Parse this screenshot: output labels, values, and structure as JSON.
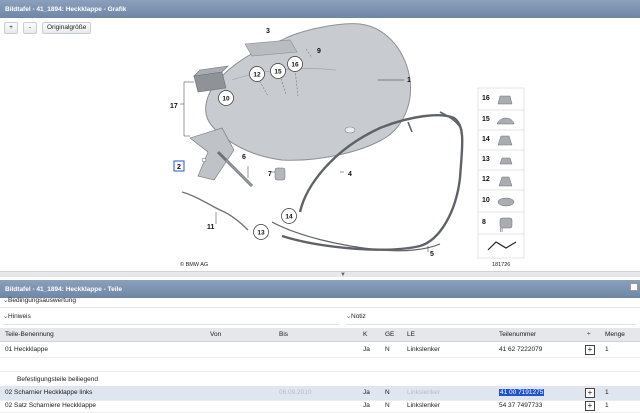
{
  "graphic_window": {
    "title": "Bildtafel - 41_1894: Heckklappe - Grafik",
    "toolbar": {
      "zoom_in": "+",
      "zoom_out": "-",
      "original_size": "Originalgröße"
    },
    "diagram": {
      "callouts": [
        "1",
        "2",
        "3",
        "4",
        "5",
        "6",
        "7",
        "8",
        "9",
        "10",
        "11",
        "12",
        "13",
        "14",
        "15",
        "16",
        "17"
      ],
      "legend_numbers": [
        "16",
        "15",
        "14",
        "13",
        "12",
        "10",
        "8"
      ],
      "legend_marks": [
        "II"
      ],
      "copyright": "© BMW AG",
      "image_number": "181726"
    }
  },
  "parts_window": {
    "title": "Bildtafel - 41_1894: Heckklappe - Teile",
    "conditions_label": "Bedingungsauswertung",
    "hints_label": "Hinweis",
    "notes_label": "Notiz",
    "columns": {
      "name": "Teile-Benennung",
      "from": "Von",
      "to": "Bis",
      "k": "K",
      "ge": "GE",
      "le": "LE",
      "part_number": "Teilenummer",
      "sort": "÷",
      "quantity": "Menge"
    },
    "rows": [
      {
        "name": "01 Heckklappe",
        "from": "",
        "to": "",
        "k": "Ja",
        "ge": "N",
        "le": "Linkslenker",
        "part_number": "41 62 7222079",
        "quantity": "1"
      },
      {
        "name": "Befestigungsteile beiliegend",
        "note": true
      },
      {
        "name": "02 Scharnier Heckklappe links",
        "from": "",
        "to": "06.09.2010",
        "k": "Ja",
        "ge": "N",
        "le": "Linkslenker",
        "part_number": "41 00 7191275",
        "quantity": "1",
        "selected": true
      },
      {
        "name": "02 Satz Scharniere Heckklappe",
        "from": "",
        "to": "",
        "k": "Ja",
        "ge": "N",
        "le": "Linkslenker",
        "part_number": "54 37 7497733",
        "quantity": "1"
      }
    ],
    "add_symbol": "+"
  }
}
